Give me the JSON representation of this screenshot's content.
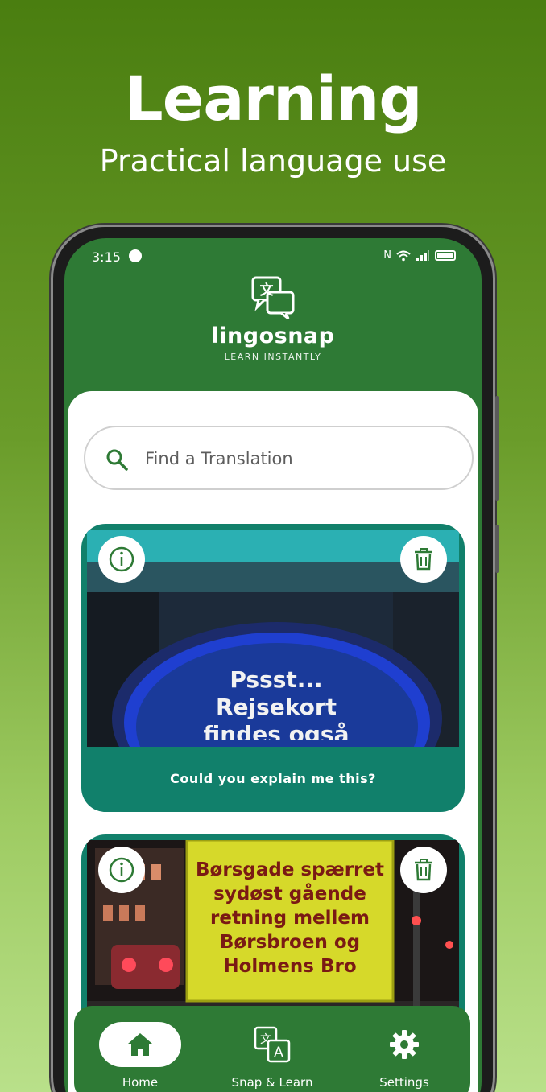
{
  "promo": {
    "title": "Learning",
    "subtitle": "Practical language use"
  },
  "status_bar": {
    "time": "3:15"
  },
  "app": {
    "name": "lingosnap",
    "tagline": "LEARN INSTANTLY"
  },
  "search": {
    "placeholder": "Find a Translation"
  },
  "cards": [
    {
      "caption": "Could you explain me this?",
      "photo_text": [
        "Pssst...",
        "Rejsekort",
        "findes også"
      ]
    },
    {
      "photo_text": [
        "Børsgade spærret",
        "sydøst gående",
        "retning mellem",
        "Børsbroen og",
        "Holmens Bro"
      ]
    }
  ],
  "nav": {
    "items": [
      {
        "label": "Home",
        "icon": "home-icon",
        "active": true
      },
      {
        "label": "Snap & Learn",
        "icon": "translate-icon",
        "active": false
      },
      {
        "label": "Settings",
        "icon": "gear-icon",
        "active": false
      }
    ]
  },
  "colors": {
    "brand_green": "#2e7a35",
    "card_teal": "#11806b"
  }
}
